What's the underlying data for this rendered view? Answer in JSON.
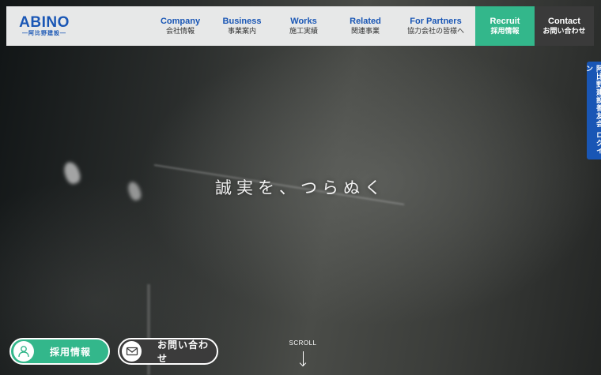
{
  "header": {
    "logo_main": "ABINO",
    "logo_sub": "―阿比野建設―",
    "nav": [
      {
        "en": "Company",
        "jp": "会社情報"
      },
      {
        "en": "Business",
        "jp": "事業案内"
      },
      {
        "en": "Works",
        "jp": "施工実績"
      },
      {
        "en": "Related",
        "jp": "関連事業"
      },
      {
        "en": "For Partners",
        "jp": "協力会社の皆様へ"
      },
      {
        "en": "Recruit",
        "jp": "採用情報"
      },
      {
        "en": "Contact",
        "jp": "お問い合わせ"
      }
    ]
  },
  "hero": {
    "catchphrase": "誠実を、つらぬく",
    "scroll_label": "SCROLL"
  },
  "side_tab": {
    "label": "阿比野建設善友会 ログイン"
  },
  "buttons": {
    "recruit_label": "採用情報",
    "contact_label": "お問い合わせ"
  },
  "colors": {
    "brand_blue": "#1956b5",
    "recruit_green": "#33b78b",
    "contact_dark": "#3a3a3a",
    "header_bg": "#e7e8e8"
  },
  "icons": {
    "recruit": "person-icon",
    "contact": "mail-icon",
    "scroll": "arrow-down-icon"
  }
}
